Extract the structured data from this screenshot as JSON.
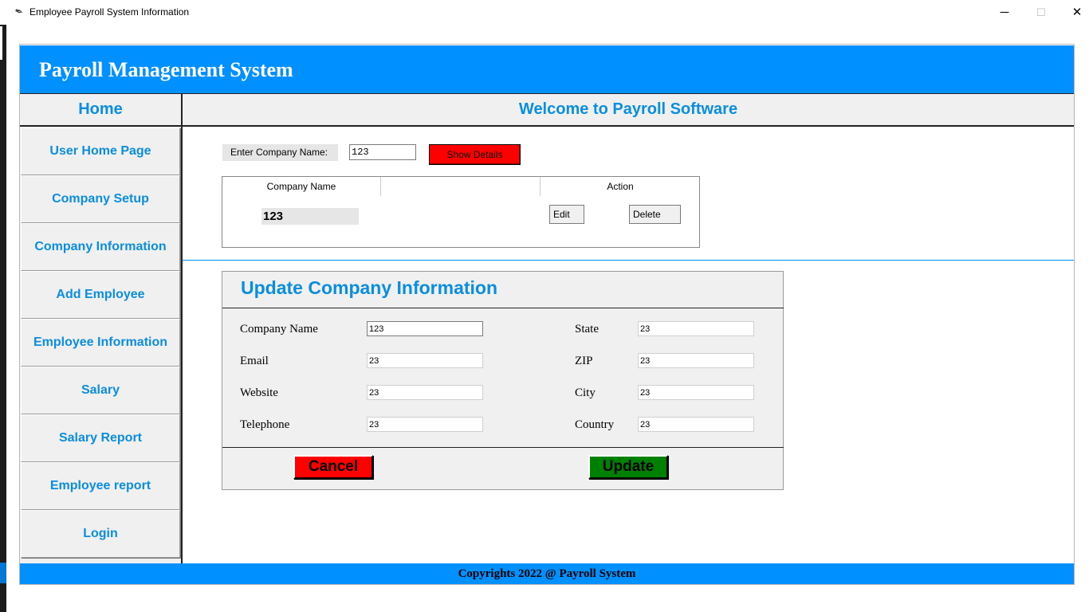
{
  "window": {
    "title": "Employee Payroll System Information",
    "minimize_glyph": "─",
    "maximize_glyph": "☐",
    "close_glyph": "✕",
    "app_icon": "feather-icon"
  },
  "header": {
    "title": "Payroll Management System"
  },
  "sidebar": {
    "home_label": "Home",
    "items": [
      {
        "label": "User Home Page"
      },
      {
        "label": "Company Setup"
      },
      {
        "label": "Company Information"
      },
      {
        "label": "Add Employee"
      },
      {
        "label": "Employee Information"
      },
      {
        "label": "Salary"
      },
      {
        "label": "Salary Report"
      },
      {
        "label": "Employee report"
      },
      {
        "label": "Login"
      }
    ]
  },
  "main": {
    "welcome": "Welcome to Payroll Software",
    "search": {
      "label": "Enter Company Name:",
      "value": "123",
      "button_label": "Show Details"
    },
    "table": {
      "headers": [
        "Company Name",
        "",
        "Action"
      ],
      "rows": [
        {
          "company_name": "123",
          "edit_label": "Edit",
          "delete_label": "Delete"
        }
      ]
    },
    "update_form": {
      "title": "Update Company Information",
      "fields_left": [
        {
          "label": "Company Name",
          "value": "123"
        },
        {
          "label": "Email",
          "value": "23"
        },
        {
          "label": "Website",
          "value": "23"
        },
        {
          "label": "Telephone",
          "value": "23"
        }
      ],
      "fields_right": [
        {
          "label": "State",
          "value": "23"
        },
        {
          "label": "ZIP",
          "value": "23"
        },
        {
          "label": "City",
          "value": "23"
        },
        {
          "label": "Country",
          "value": "23"
        }
      ],
      "cancel_label": "Cancel",
      "update_label": "Update"
    }
  },
  "footer": {
    "text": "Copyrights 2022 @ Payroll System"
  },
  "colors": {
    "brand_blue": "#0090ff",
    "link_blue": "#0b8de0",
    "danger_red": "#ff0000",
    "success_green": "#008000"
  }
}
